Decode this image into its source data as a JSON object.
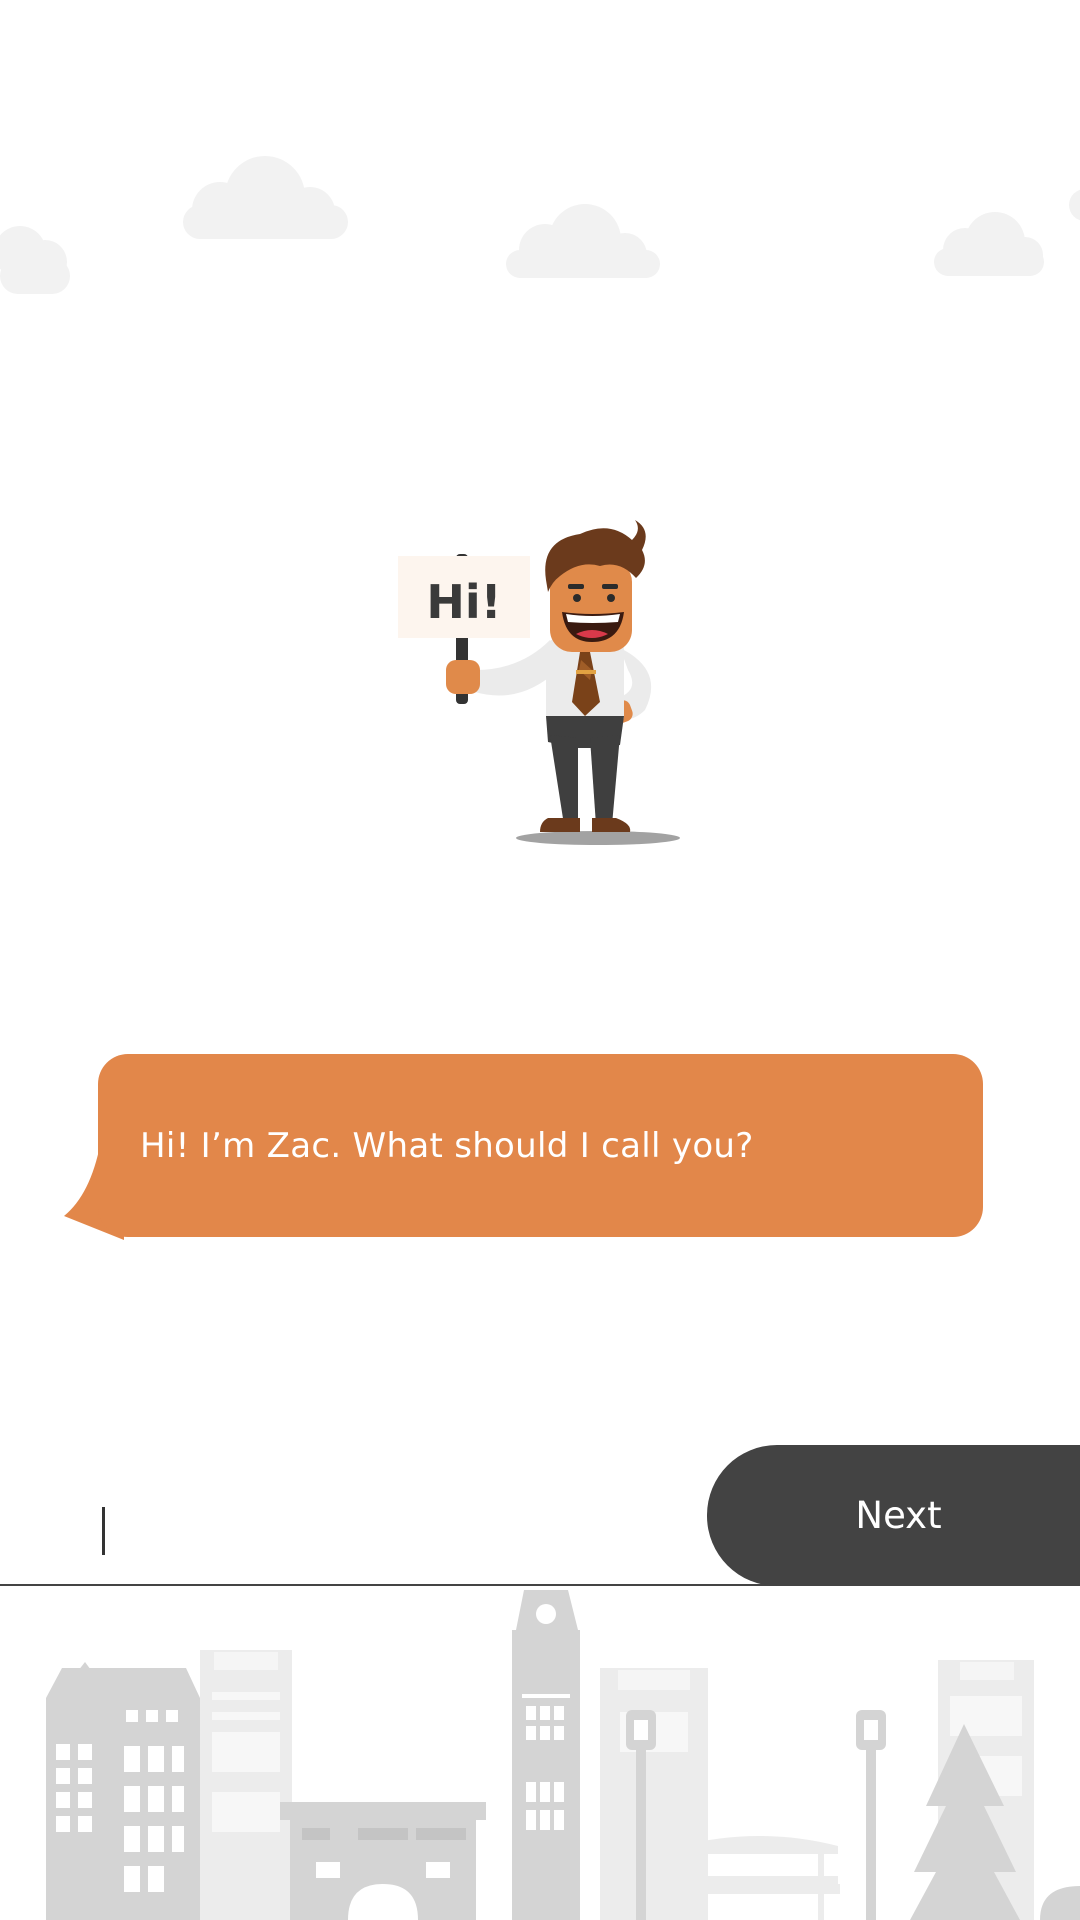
{
  "colors": {
    "accent": "#e2874a",
    "button": "#434343",
    "cloud": "#f2f2f2",
    "skyline_light": "#ececec",
    "skyline_dark": "#d4d4d4"
  },
  "mascot": {
    "sign_text": "Hi!"
  },
  "chat": {
    "message": "Hi! I’m Zac. What should I call you?"
  },
  "input": {
    "value": "",
    "placeholder": ""
  },
  "actions": {
    "next_label": "Next"
  }
}
